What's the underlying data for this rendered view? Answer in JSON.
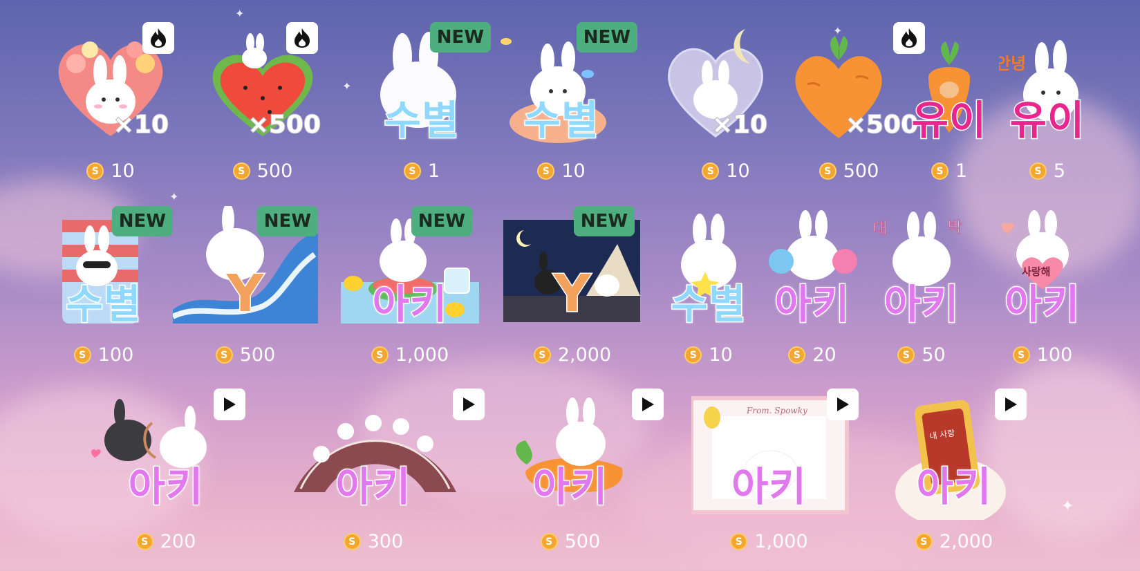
{
  "gifts": [
    {
      "label": "",
      "mult": "×10",
      "price": "10",
      "badge": "fire",
      "badge_icon": "fire-icon"
    },
    {
      "label": "",
      "mult": "×500",
      "price": "500",
      "badge": "fire",
      "badge_icon": "fire-icon"
    },
    {
      "label": "수별",
      "price": "1",
      "badge": "NEW"
    },
    {
      "label": "수별",
      "price": "10",
      "badge": "NEW"
    },
    {
      "label": "",
      "mult": "×10",
      "price": "10"
    },
    {
      "label": "",
      "mult": "×500",
      "price": "500",
      "badge": "fire",
      "badge_icon": "fire-icon"
    },
    {
      "label": "유이",
      "price": "1"
    },
    {
      "label": "유이",
      "price": "5"
    },
    {
      "label": "수별",
      "price": "100",
      "badge": "NEW"
    },
    {
      "label": "Y",
      "price": "500",
      "badge": "NEW"
    },
    {
      "label": "아키",
      "price": "1,000",
      "badge": "NEW"
    },
    {
      "label": "Y",
      "price": "2,000",
      "badge": "NEW"
    },
    {
      "label": "수별",
      "price": "10"
    },
    {
      "label": "아키",
      "price": "20"
    },
    {
      "label": "아키",
      "price": "50"
    },
    {
      "label": "아키",
      "price": "100"
    },
    {
      "label": "아키",
      "price": "200",
      "badge": "play",
      "badge_icon": "play-icon"
    },
    {
      "label": "아키",
      "price": "300",
      "badge": "play",
      "badge_icon": "play-icon"
    },
    {
      "label": "아키",
      "price": "500",
      "badge": "play",
      "badge_icon": "play-icon"
    },
    {
      "label": "아키",
      "price": "1,000",
      "badge": "play",
      "badge_icon": "play-icon"
    },
    {
      "label": "아키",
      "price": "2,000",
      "badge": "play",
      "badge_icon": "play-icon"
    }
  ],
  "coin_symbol": "S",
  "decor_texts": {
    "yui_sign": "안녕",
    "daebak_left": "대",
    "daebak_right": "박",
    "love": "사랑해",
    "from": "From. Spowky",
    "phone": "내 사랑"
  }
}
